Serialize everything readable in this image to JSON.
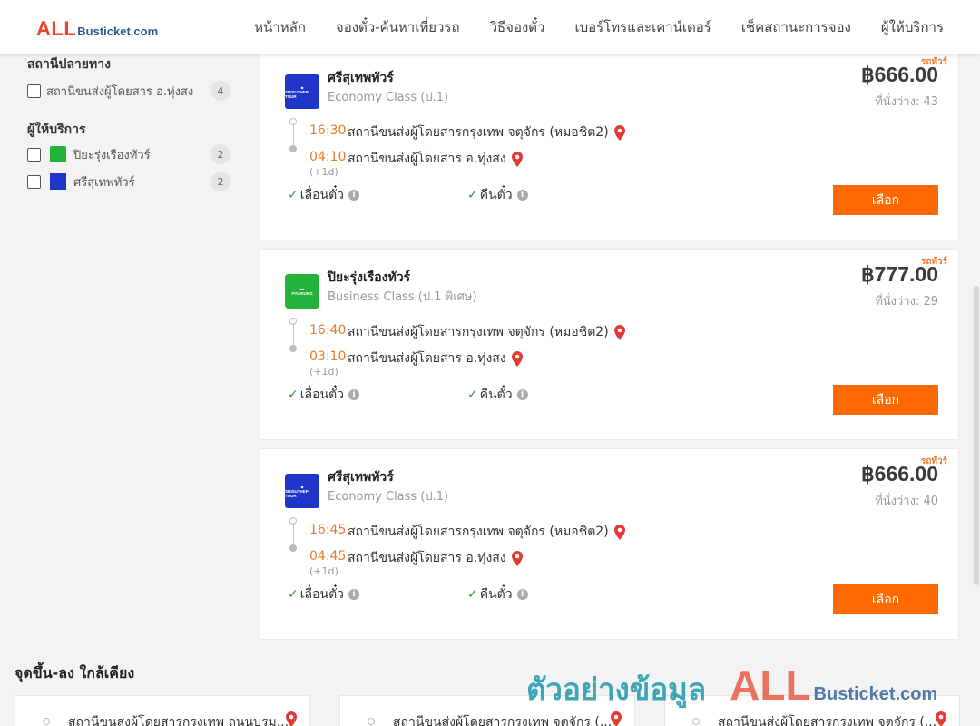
{
  "header": {
    "logo_main": "ALL",
    "logo_rest": "Busticket.com",
    "nav": [
      "หน้าหลัก",
      "จองตั๋ว-ค้นหาเที่ยวรถ",
      "วิธีจองตั๋ว",
      "เบอร์โทรและเคาน์เตอร์",
      "เช็คสถานะการจอง",
      "ผู้ให้บริการ"
    ]
  },
  "sidebar": {
    "destination_title": "สถานีปลายทาง",
    "destinations": [
      {
        "label": "สถานีขนส่งผู้โดยสาร อ.ทุ่งสง",
        "count": "4"
      }
    ],
    "operator_title": "ผู้ให้บริการ",
    "operators": [
      {
        "label": "ปิยะรุ่งเรืองทัวร์",
        "count": "2",
        "logo": "green"
      },
      {
        "label": "ศรีสุเทพทัวร์",
        "count": "2",
        "logo": "blue"
      }
    ]
  },
  "trips": [
    {
      "tag": "รถทัวร์",
      "operator": "ศรีสุเทพทัวร์",
      "bus_class": "Economy Class (ป.1)",
      "logo": "blue",
      "price": "฿666.00",
      "seats": "ที่นั่งว่าง: 43",
      "depart_time": "16:30",
      "depart_station": "สถานีขนส่งผู้โดยสารกรุงเทพ จตุจักร (หมอชิต2)",
      "arrive_time": "04:10",
      "arrive_station": "สถานีขนส่งผู้โดยสาร อ.ทุ่งสง",
      "plus_day": "(+1d)",
      "feature_1": "เลื่อนตั๋ว",
      "feature_2": "คืนตั๋ว",
      "button": "เลือก"
    },
    {
      "tag": "รถทัวร์",
      "operator": "ปิยะรุ่งเรืองทัวร์",
      "bus_class": "Business Class (ป.1 พิเศษ)",
      "logo": "green",
      "price": "฿777.00",
      "seats": "ที่นั่งว่าง: 29",
      "depart_time": "16:40",
      "depart_station": "สถานีขนส่งผู้โดยสารกรุงเทพ จตุจักร (หมอชิต2)",
      "arrive_time": "03:10",
      "arrive_station": "สถานีขนส่งผู้โดยสาร อ.ทุ่งสง",
      "plus_day": "(+1d)",
      "feature_1": "เลื่อนตั๋ว",
      "feature_2": "คืนตั๋ว",
      "button": "เลือก"
    },
    {
      "tag": "รถทัวร์",
      "operator": "ศรีสุเทพทัวร์",
      "bus_class": "Economy Class (ป.1)",
      "logo": "blue",
      "price": "฿666.00",
      "seats": "ที่นั่งว่าง: 40",
      "depart_time": "16:45",
      "depart_station": "สถานีขนส่งผู้โดยสารกรุงเทพ จตุจักร (หมอชิต2)",
      "arrive_time": "04:45",
      "arrive_station": "สถานีขนส่งผู้โดยสาร อ.ทุ่งสง",
      "plus_day": "(+1d)",
      "feature_1": "เลื่อนตั๋ว",
      "feature_2": "คืนตั๋ว",
      "button": "เลือก"
    }
  ],
  "nearby": {
    "title": "จุดขึ้น-ลง ใกล้เคียง",
    "items": [
      "สถานีขนส่งผู้โดยสารกรุงเทพ ถนนบรม...",
      "สถานีขนส่งผู้โดยสารกรุงเทพ จตุจักร (...",
      "สถานีขนส่งผู้โดยสารกรุงเทพ จตุจักร (..."
    ]
  },
  "watermark": {
    "thai": "ตัวอย่างข้อมูล",
    "all": "ALL",
    "rest": "Busticket.com"
  },
  "colors": {
    "accent_orange": "#ff6a00",
    "time_orange": "#e87c2a",
    "pin_red": "#e53935",
    "check_green": "#2e9d3b",
    "logo_red": "#e8472e",
    "logo_blue": "#2c5a8c"
  }
}
